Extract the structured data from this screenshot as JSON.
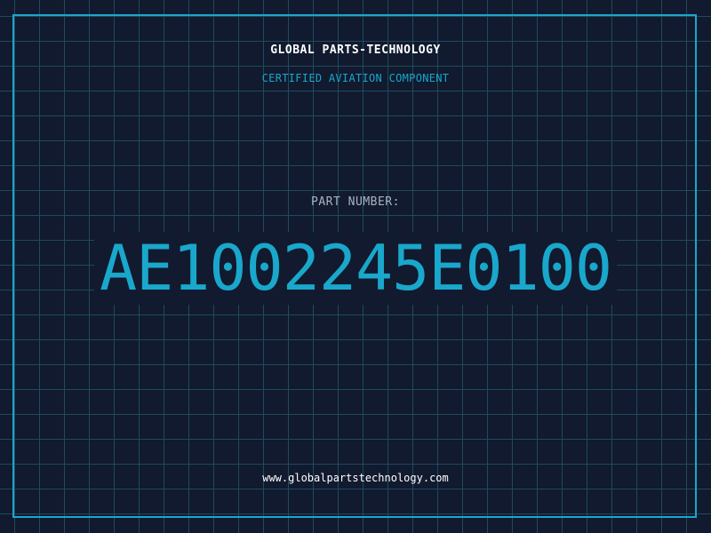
{
  "header": {
    "title": "GLOBAL PARTS-TECHNOLOGY",
    "subtitle": "CERTIFIED AVIATION COMPONENT"
  },
  "part": {
    "label": "PART NUMBER:",
    "number": "AE1002245E0100"
  },
  "footer": {
    "website": "www.globalpartstechnology.com"
  },
  "colors": {
    "background": "#111a2e",
    "grid": "#1f4a5e",
    "accent": "#1aa7cc",
    "text": "#ffffff",
    "muted": "#a9b4c2"
  }
}
